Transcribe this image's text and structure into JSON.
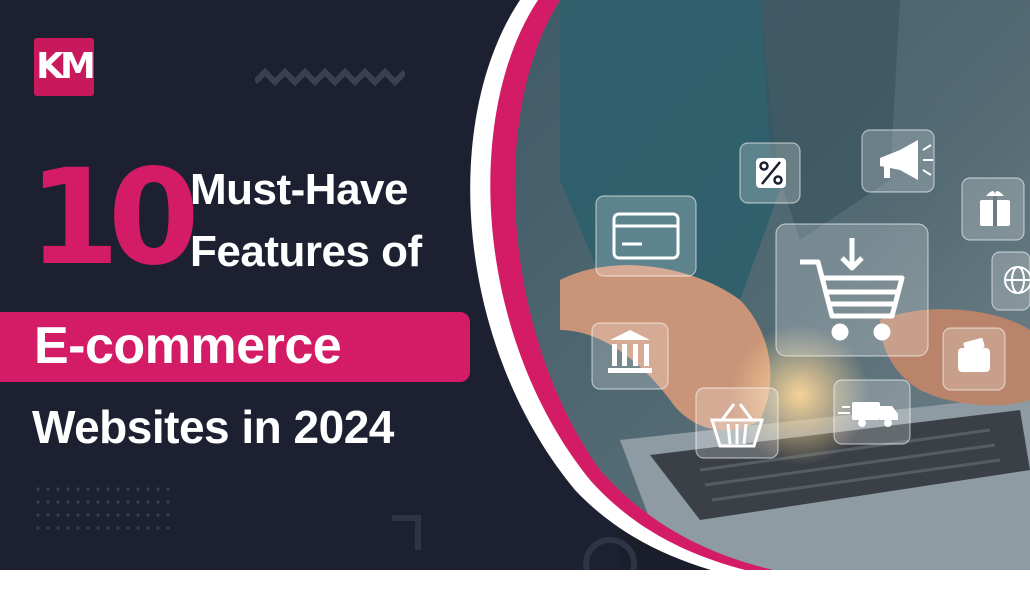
{
  "banner": {
    "logo_text": "KM",
    "headline_number": "10",
    "headline_line1": "Must-Have",
    "headline_line2": "Features of",
    "highlight": "E-commerce",
    "headline_line3": "Websites in 2024"
  },
  "colors": {
    "background": "#1c2030",
    "accent": "#d41c66",
    "text": "#ffffff"
  },
  "icons": [
    "percent-icon",
    "megaphone-icon",
    "credit-card-icon",
    "gift-icon",
    "shopping-cart-icon",
    "globe-icon",
    "bank-icon",
    "wallet-icon",
    "shopping-basket-icon",
    "delivery-truck-icon"
  ]
}
